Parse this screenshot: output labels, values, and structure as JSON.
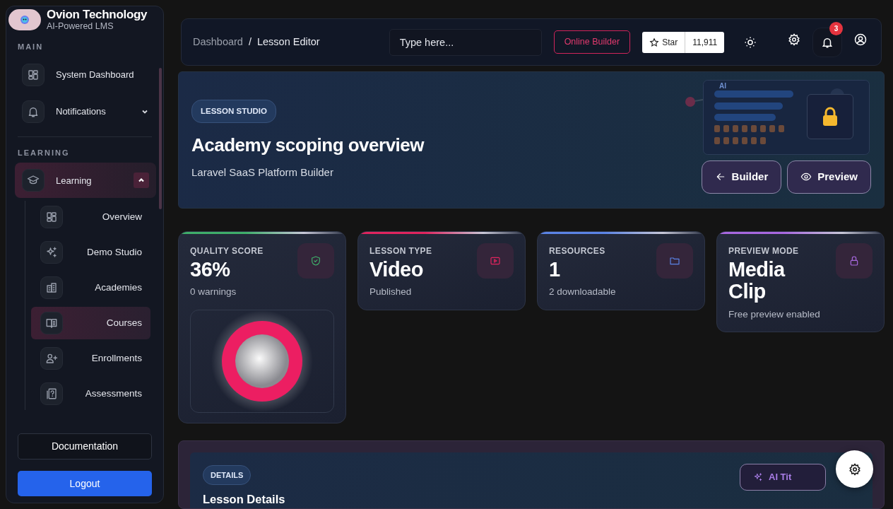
{
  "sidebar": {
    "brand": {
      "name": "Ovion Technology",
      "tagline": "AI-Powered LMS"
    },
    "sections": [
      {
        "heading": "MAIN",
        "items": [
          {
            "label": "System Dashboard",
            "selected": false
          },
          {
            "label": "Notifications",
            "selected": false,
            "expanded": false
          }
        ]
      },
      {
        "heading": "LEARNING",
        "items": [
          {
            "label": "Learning",
            "selected": true,
            "expanded": true,
            "children": [
              {
                "label": "Overview",
                "selected": false
              },
              {
                "label": "Demo Studio",
                "selected": false
              },
              {
                "label": "Academies",
                "selected": false
              },
              {
                "label": "Courses",
                "selected": true
              },
              {
                "label": "Enrollments",
                "selected": false
              },
              {
                "label": "Assessments",
                "selected": false
              }
            ]
          }
        ]
      }
    ],
    "footer_buttons": [
      {
        "label": "Documentation",
        "kind": "outline"
      },
      {
        "label": "Logout",
        "kind": "primary"
      }
    ]
  },
  "topbar": {
    "breadcrumb": [
      "Dashboard",
      "Lesson Editor"
    ],
    "separator": "/",
    "search": {
      "placeholder": "Type here..."
    },
    "builder_button": "Online Builder",
    "star": {
      "label": "Star",
      "count": "11,911"
    },
    "notification_count": "3"
  },
  "hero": {
    "badge": "LESSON STUDIO",
    "title": "Academy scoping overview",
    "subtitle": "Laravel SaaS Platform Builder",
    "illustration_label": "AI",
    "buttons": [
      {
        "label": "Builder",
        "kind": "back"
      },
      {
        "label": "Preview",
        "kind": "preview"
      }
    ]
  },
  "stats": [
    {
      "label": "QUALITY SCORE",
      "value": "36%",
      "caption": "0 warnings",
      "color": "#3fae6a"
    },
    {
      "label": "LESSON TYPE",
      "value": "Video",
      "caption": "Published",
      "color": "#e0245e"
    },
    {
      "label": "RESOURCES",
      "value": "1",
      "caption": "2 downloadable",
      "color": "#5b84e6"
    },
    {
      "label": "PREVIEW MODE",
      "value": "Media Clip",
      "caption": "Free preview enabled",
      "color": "#a868e0"
    }
  ],
  "details": {
    "badge": "DETAILS",
    "title": "Lesson Details",
    "ai_button": "AI Tit"
  }
}
